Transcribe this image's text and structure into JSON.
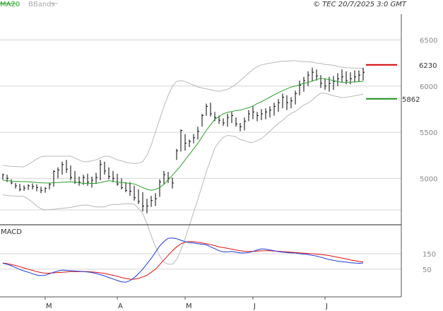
{
  "header": {
    "legend_ma": "MA20",
    "legend_bb": "BBands",
    "copyright": "© TEC 20/7/2025 3:0 GMT"
  },
  "colors": {
    "ma": "#2ca02c",
    "bands": "#b8b8b8",
    "bars": "#000000",
    "macd": "#1f3bd6",
    "signal": "#e01010",
    "resistance": "#d40000",
    "support": "#1a8f1a",
    "grid": "#d6d6d6"
  },
  "price_panel": {
    "y_ticks": [
      "6500",
      "6000",
      "5500",
      "5000"
    ],
    "y_values": [
      6500,
      6000,
      5500,
      5000
    ],
    "ylim": [
      4520,
      6780
    ],
    "resistance": {
      "label": "6230",
      "value": 6230
    },
    "support": {
      "label": "5862",
      "value": 5862
    }
  },
  "macd_panel": {
    "title": "MACD",
    "y_ticks": [
      "150",
      "50"
    ],
    "y_values": [
      150,
      50
    ],
    "ylim": [
      -130,
      320
    ]
  },
  "x_axis": {
    "months": [
      "M",
      "A",
      "M",
      "J",
      "J"
    ],
    "month_index": [
      10,
      27,
      43,
      59,
      76
    ]
  },
  "chart_data": {
    "type": "ohlc",
    "bar_count": 86,
    "series": [
      {
        "name": "MA20",
        "values": [
          4980,
          4975,
          4970,
          4968,
          4966,
          4965,
          4962,
          4960,
          4955,
          4952,
          4950,
          4950,
          4952,
          4955,
          4958,
          4960,
          4962,
          4958,
          4952,
          4945,
          4945,
          4945,
          4945,
          4955,
          4965,
          4975,
          4968,
          4958,
          4955,
          4950,
          4945,
          4940,
          4920,
          4900,
          4880,
          4870,
          4880,
          4900,
          4935,
          4985,
          5035,
          5085,
          5140,
          5200,
          5260,
          5320,
          5380,
          5450,
          5520,
          5580,
          5640,
          5670,
          5700,
          5715,
          5725,
          5735,
          5740,
          5755,
          5765,
          5785,
          5810,
          5830,
          5855,
          5880,
          5905,
          5930,
          5950,
          5970,
          5990,
          6000,
          6015,
          6030,
          6040,
          6055,
          6070,
          6085,
          6080,
          6070,
          6060,
          6050,
          6040,
          6040,
          6042,
          6045,
          6048,
          6052
        ]
      },
      {
        "name": "Upper band",
        "values": [
          5140,
          5135,
          5130,
          5128,
          5126,
          5125,
          5150,
          5180,
          5210,
          5235,
          5240,
          5240,
          5240,
          5240,
          5240,
          5240,
          5240,
          5220,
          5200,
          5180,
          5180,
          5190,
          5200,
          5220,
          5240,
          5240,
          5220,
          5200,
          5190,
          5175,
          5165,
          5160,
          5165,
          5180,
          5250,
          5360,
          5500,
          5640,
          5780,
          5900,
          6000,
          6050,
          6060,
          6050,
          6030,
          6010,
          5990,
          5980,
          5970,
          5960,
          5950,
          5945,
          5955,
          5965,
          5990,
          6020,
          6060,
          6100,
          6140,
          6180,
          6210,
          6230,
          6240,
          6250,
          6255,
          6265,
          6270,
          6270,
          6275,
          6275,
          6270,
          6265,
          6265,
          6260,
          6250,
          6245,
          6235,
          6230,
          6225,
          6215,
          6205,
          6200,
          6198,
          6195,
          6193,
          6190
        ]
      },
      {
        "name": "Lower band",
        "values": [
          4820,
          4815,
          4810,
          4808,
          4806,
          4805,
          4775,
          4740,
          4700,
          4670,
          4660,
          4660,
          4665,
          4670,
          4675,
          4680,
          4685,
          4695,
          4705,
          4710,
          4710,
          4700,
          4690,
          4690,
          4690,
          4710,
          4716,
          4716,
          4720,
          4725,
          4725,
          4720,
          4675,
          4620,
          4510,
          4380,
          4260,
          4160,
          4090,
          4070,
          4070,
          4120,
          4220,
          4350,
          4490,
          4630,
          4770,
          4920,
          5070,
          5200,
          5330,
          5395,
          5445,
          5465,
          5460,
          5450,
          5420,
          5410,
          5390,
          5390,
          5410,
          5430,
          5470,
          5510,
          5555,
          5595,
          5630,
          5670,
          5705,
          5725,
          5760,
          5795,
          5815,
          5850,
          5890,
          5925,
          5925,
          5910,
          5895,
          5885,
          5875,
          5880,
          5886,
          5895,
          5903,
          5914
        ]
      },
      {
        "name": "MACD",
        "values": [
          88,
          82,
          72,
          60,
          48,
          38,
          30,
          20,
          12,
          8,
          10,
          20,
          30,
          38,
          44,
          42,
          40,
          38,
          36,
          34,
          32,
          28,
          22,
          14,
          6,
          -4,
          -14,
          -24,
          -32,
          -35,
          -25,
          -5,
          20,
          50,
          85,
          120,
          160,
          200,
          230,
          250,
          252,
          248,
          238,
          228,
          222,
          220,
          215,
          212,
          208,
          195,
          183,
          170,
          163,
          163,
          165,
          160,
          155,
          155,
          158,
          165,
          175,
          182,
          180,
          175,
          170,
          164,
          160,
          158,
          155,
          155,
          150,
          148,
          145,
          140,
          135,
          128,
          120,
          112,
          108,
          102,
          98,
          96,
          92,
          90,
          88,
          90
        ]
      },
      {
        "name": "Signal",
        "values": [
          90,
          86,
          80,
          74,
          66,
          58,
          50,
          42,
          34,
          28,
          24,
          24,
          26,
          28,
          30,
          32,
          34,
          34,
          34,
          34,
          34,
          32,
          30,
          26,
          22,
          16,
          10,
          4,
          -4,
          -10,
          -15,
          -15,
          -10,
          0,
          10,
          30,
          50,
          80,
          110,
          140,
          170,
          195,
          215,
          225,
          230,
          228,
          225,
          220,
          215,
          210,
          203,
          195,
          190,
          185,
          180,
          175,
          170,
          166,
          165,
          165,
          167,
          169,
          170,
          170,
          168,
          166,
          164,
          162,
          160,
          158,
          156,
          154,
          152,
          150,
          148,
          145,
          142,
          138,
          133,
          127,
          122,
          116,
          110,
          105,
          100,
          96
        ]
      }
    ],
    "bars": [
      [
        5050,
        4985,
        5040
      ],
      [
        5040,
        4960,
        5000
      ],
      [
        4990,
        4935,
        4950
      ],
      [
        4950,
        4890,
        4920
      ],
      [
        4940,
        4860,
        4880
      ],
      [
        4925,
        4865,
        4895
      ],
      [
        4935,
        4875,
        4920
      ],
      [
        4945,
        4880,
        4910
      ],
      [
        4935,
        4860,
        4900
      ],
      [
        4910,
        4840,
        4870
      ],
      [
        4905,
        4845,
        4890
      ],
      [
        4950,
        4880,
        4935
      ],
      [
        5090,
        4910,
        5075
      ],
      [
        5120,
        5000,
        5090
      ],
      [
        5180,
        5040,
        5150
      ],
      [
        5200,
        5060,
        5100
      ],
      [
        5140,
        4980,
        5010
      ],
      [
        5080,
        4940,
        4960
      ],
      [
        5020,
        4920,
        4960
      ],
      [
        5040,
        4930,
        5010
      ],
      [
        5050,
        4920,
        4960
      ],
      [
        5020,
        4900,
        4980
      ],
      [
        5060,
        4940,
        5010
      ],
      [
        5200,
        4980,
        5150
      ],
      [
        5180,
        5040,
        5080
      ],
      [
        5120,
        4990,
        5020
      ],
      [
        5080,
        4960,
        5000
      ],
      [
        5050,
        4920,
        4940
      ],
      [
        5000,
        4880,
        4900
      ],
      [
        4960,
        4850,
        4870
      ],
      [
        4960,
        4810,
        4860
      ],
      [
        4920,
        4760,
        4790
      ],
      [
        4880,
        4720,
        4750
      ],
      [
        4850,
        4640,
        4700
      ],
      [
        4780,
        4620,
        4700
      ],
      [
        4810,
        4690,
        4760
      ],
      [
        4840,
        4700,
        4780
      ],
      [
        4990,
        4800,
        4960
      ],
      [
        5080,
        4930,
        5040
      ],
      [
        5070,
        4950,
        5000
      ],
      [
        5010,
        4890,
        4950
      ],
      [
        5320,
        5200,
        5300
      ],
      [
        5530,
        5290,
        5520
      ],
      [
        5480,
        5300,
        5380
      ],
      [
        5420,
        5340,
        5400
      ],
      [
        5480,
        5380,
        5440
      ],
      [
        5560,
        5420,
        5510
      ],
      [
        5700,
        5560,
        5680
      ],
      [
        5810,
        5680,
        5780
      ],
      [
        5820,
        5670,
        5700
      ],
      [
        5720,
        5620,
        5660
      ],
      [
        5680,
        5590,
        5630
      ],
      [
        5650,
        5570,
        5600
      ],
      [
        5700,
        5560,
        5660
      ],
      [
        5720,
        5600,
        5680
      ],
      [
        5660,
        5560,
        5590
      ],
      [
        5600,
        5510,
        5560
      ],
      [
        5660,
        5520,
        5620
      ],
      [
        5740,
        5620,
        5700
      ],
      [
        5780,
        5640,
        5720
      ],
      [
        5720,
        5620,
        5680
      ],
      [
        5750,
        5630,
        5700
      ],
      [
        5760,
        5640,
        5720
      ],
      [
        5780,
        5660,
        5740
      ],
      [
        5820,
        5680,
        5780
      ],
      [
        5860,
        5720,
        5820
      ],
      [
        5920,
        5760,
        5880
      ],
      [
        5900,
        5740,
        5820
      ],
      [
        5880,
        5760,
        5840
      ],
      [
        5950,
        5800,
        5920
      ],
      [
        6060,
        5900,
        6010
      ],
      [
        6100,
        5940,
        6060
      ],
      [
        6160,
        6000,
        6120
      ],
      [
        6200,
        6050,
        6150
      ],
      [
        6180,
        6060,
        6110
      ],
      [
        6120,
        5980,
        6030
      ],
      [
        6080,
        5960,
        6000
      ],
      [
        6100,
        5940,
        6030
      ],
      [
        6110,
        5960,
        6050
      ],
      [
        6140,
        6000,
        6080
      ],
      [
        6180,
        6040,
        6100
      ],
      [
        6160,
        6020,
        6060
      ],
      [
        6150,
        6020,
        6080
      ],
      [
        6170,
        6040,
        6100
      ],
      [
        6170,
        6050,
        6120
      ],
      [
        6200,
        6060,
        6150
      ]
    ]
  }
}
